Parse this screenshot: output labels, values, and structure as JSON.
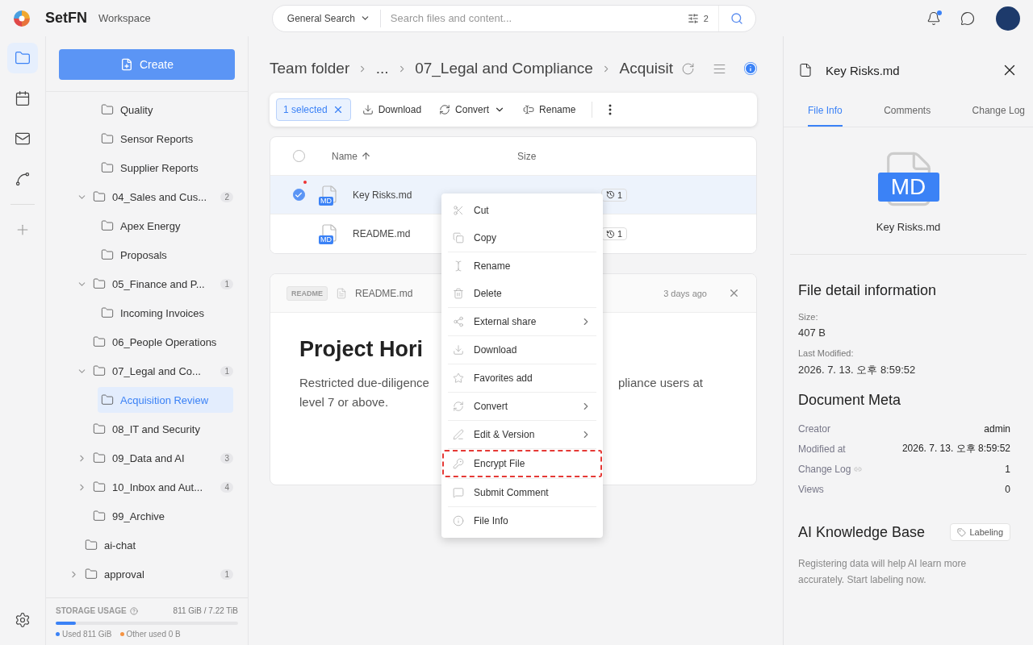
{
  "app": {
    "brand": "SetFN",
    "section": "Workspace"
  },
  "search": {
    "scope": "General Search",
    "placeholder": "Search files and content...",
    "filter_count": "2"
  },
  "header": {
    "notification_unread": true
  },
  "rail": [
    {
      "selected": true
    },
    {
      "selected": false
    },
    {
      "selected": false
    },
    {
      "selected": false
    }
  ],
  "sidebar": {
    "create_label": "Create",
    "tree": [
      {
        "children": [
          {
            "children": [
              {
                "label": "Quality",
                "selected": false
              },
              {
                "label": "Sensor Reports",
                "selected": false
              },
              {
                "label": "Supplier Reports",
                "selected": false
              }
            ]
          },
          {
            "label": "04_Sales and Cus...",
            "count": "2",
            "expanded": true,
            "selected": false,
            "children": [
              {
                "label": "Apex Energy",
                "selected": false
              },
              {
                "label": "Proposals",
                "selected": false
              }
            ]
          },
          {
            "label": "05_Finance and P...",
            "count": "1",
            "expanded": true,
            "selected": false,
            "children": [
              {
                "label": "Incoming Invoices",
                "selected": false
              }
            ]
          },
          {
            "label": "06_People Operations",
            "selected": false
          },
          {
            "label": "07_Legal and Co...",
            "count": "1",
            "expanded": true,
            "selected": false,
            "children": [
              {
                "label": "Acquisition Review",
                "selected": true
              }
            ]
          },
          {
            "label": "08_IT and Security",
            "selected": false
          },
          {
            "label": "09_Data and AI",
            "count": "3",
            "expanded": false,
            "selected": false
          },
          {
            "label": "10_Inbox and Aut...",
            "count": "4",
            "expanded": false,
            "selected": false
          },
          {
            "label": "99_Archive",
            "selected": false
          }
        ]
      },
      {
        "label": "ai-chat",
        "selected": false
      },
      {
        "label": "approval",
        "count": "1",
        "expanded": false,
        "selected": false
      }
    ],
    "storage": {
      "title": "STORAGE USAGE",
      "total": "811 GiB / 7.22 TiB",
      "level": 0.11,
      "used": "Used 811 GiB",
      "other": "Other used 0 B"
    }
  },
  "breadcrumb": [
    "Team folder",
    "...",
    "07_Legal and Compliance",
    "Acquisit"
  ],
  "toolbar": {
    "selection": "1 selected",
    "actions": [
      {
        "label": "Download",
        "dropdown": false
      },
      {
        "label": "Convert",
        "dropdown": true
      },
      {
        "label": "Rename",
        "dropdown": false
      }
    ]
  },
  "table": {
    "columns": [
      "Name",
      "Size"
    ],
    "all_checked": false,
    "rows": [
      {
        "name": "Key Risks.md",
        "type": "MD",
        "versions": "1",
        "checked": true,
        "selected": true,
        "unread": true
      },
      {
        "name": "README.md",
        "type": "MD",
        "versions": "1",
        "checked": false,
        "selected": false,
        "unread": false
      }
    ]
  },
  "preview": {
    "tag": "README",
    "file": "README.md",
    "time": "3 days ago",
    "heading": "Project Hori",
    "text_left": [
      "Restricted due-diligence",
      "level 7 or above."
    ],
    "text_right": "pliance users at"
  },
  "context_menu": [
    [
      {
        "label": "Cut",
        "submenu": false
      },
      {
        "label": "Copy",
        "submenu": false
      }
    ],
    [
      {
        "label": "Rename",
        "submenu": false
      },
      {
        "label": "Delete",
        "submenu": false
      }
    ],
    [
      {
        "label": "External share",
        "submenu": true
      }
    ],
    [
      {
        "label": "Download",
        "submenu": false
      }
    ],
    [
      {
        "label": "Favorites add",
        "submenu": false
      }
    ],
    [
      {
        "label": "Convert",
        "submenu": true
      }
    ],
    [
      {
        "label": "Edit & Version",
        "submenu": true
      }
    ],
    [
      {
        "label": "Encrypt File",
        "submenu": false,
        "highlighted": true
      }
    ],
    [
      {
        "label": "Submit Comment",
        "submenu": false
      }
    ],
    [
      {
        "label": "File Info",
        "submenu": false
      }
    ]
  ],
  "details": {
    "title": "Key Risks.md",
    "tabs": [
      {
        "label": "File Info",
        "selected": true
      },
      {
        "label": "Comments",
        "selected": false
      },
      {
        "label": "Change Log",
        "selected": false
      }
    ],
    "file_type": "MD",
    "file_name": "Key Risks.md",
    "info_title": "File detail information",
    "info": [
      {
        "label": "Size:",
        "value": "407 B"
      },
      {
        "label": "Last Modified:",
        "value": "2026. 7. 13. 오후 8:59:52"
      }
    ],
    "meta_title": "Document Meta",
    "meta": [
      {
        "label": "Creator",
        "value": "admin",
        "link": false
      },
      {
        "label": "Modified at",
        "value": "2026. 7. 13. 오후 8:59:52",
        "link": false
      },
      {
        "label": "Change Log",
        "value": "1",
        "link": true
      },
      {
        "label": "Views",
        "value": "0",
        "link": false
      }
    ],
    "ai_title": "AI Knowledge Base",
    "ai_button": "Labeling",
    "ai_text": "Registering data will help AI learn more accurately. Start labeling now."
  }
}
